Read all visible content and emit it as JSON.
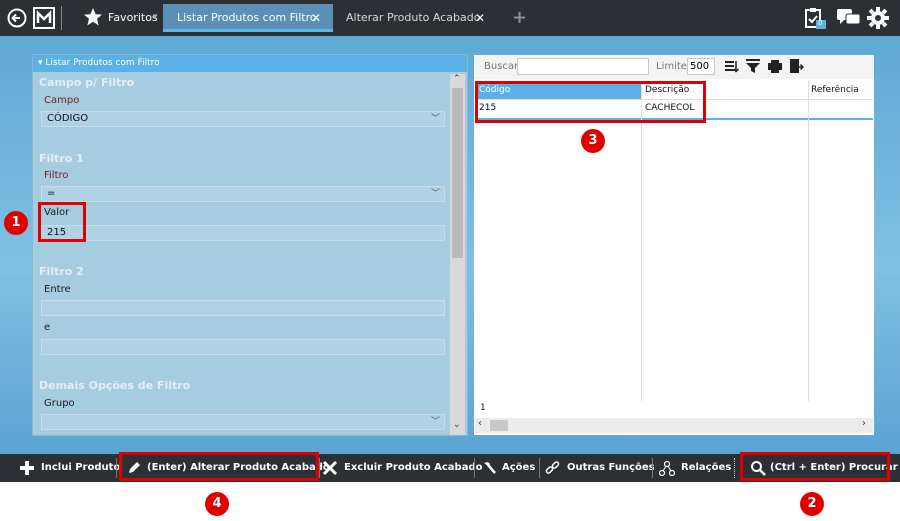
{
  "topbar": {
    "favorites_label": "Favoritos",
    "favorites_caret": "▾",
    "tabs": [
      {
        "label": "Listar Produtos com Filtro",
        "close": "✕"
      },
      {
        "label": "Alterar Produto Acabado",
        "close": "✕"
      }
    ],
    "new_tab": "+",
    "tasks_badge": "0"
  },
  "left_panel": {
    "header": "▾ Listar Produtos com Filtro",
    "section_campo": "Campo p/ Filtro",
    "campo_label": "Campo",
    "campo_value": "CÓDIGO",
    "section_filtro1": "Filtro 1",
    "filtro_label": "Filtro",
    "filtro_value": "=",
    "valor_label": "Valor",
    "valor_value": "215",
    "section_filtro2": "Filtro 2",
    "entre_label": "Entre",
    "entre_value": "",
    "e_label": "e",
    "e_value": "",
    "section_demais": "Demais Opções de Filtro",
    "grupo_label": "Grupo",
    "grupo_value": ""
  },
  "right_panel": {
    "buscar_placeholder": "Buscar",
    "limite_label": "Limite",
    "limite_value": "500",
    "columns": [
      "Código",
      "Descrição",
      "Referência"
    ],
    "rows": [
      [
        "215",
        "CACHECOL",
        ""
      ]
    ],
    "record_count": "1"
  },
  "bottom_toolbar": {
    "inclui": "Inclui Produto",
    "alterar": "(Enter) Alterar Produto Acabado",
    "excluir": "Excluir Produto Acabado",
    "acoes": "Ações",
    "outras": "Outras Funções",
    "relacoes": "Relações",
    "procurar": "(Ctrl + Enter) Procurar"
  },
  "annotations": [
    "1",
    "2",
    "3",
    "4"
  ],
  "colors": {
    "accent": "#5ab1e5",
    "annotation_red": "#e00000",
    "dark_bar": "#2c2f33"
  }
}
